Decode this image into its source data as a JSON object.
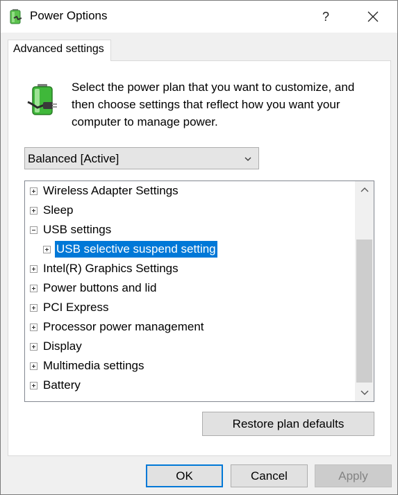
{
  "window": {
    "title": "Power Options",
    "help_label": "?",
    "close_icon": "close-icon",
    "app_icon": "power-options-icon"
  },
  "tabs": [
    {
      "label": "Advanced settings",
      "active": true
    }
  ],
  "description": "Select the power plan that you want to customize, and then choose settings that reflect how you want your computer to manage power.",
  "plan_select": {
    "value": "Balanced [Active]"
  },
  "tree": {
    "items": [
      {
        "label": "Wireless Adapter Settings",
        "expanded": false,
        "level": 0,
        "selected": false
      },
      {
        "label": "Sleep",
        "expanded": false,
        "level": 0,
        "selected": false
      },
      {
        "label": "USB settings",
        "expanded": true,
        "level": 0,
        "selected": false
      },
      {
        "label": "USB selective suspend setting",
        "expanded": false,
        "level": 1,
        "selected": true
      },
      {
        "label": "Intel(R) Graphics Settings",
        "expanded": false,
        "level": 0,
        "selected": false
      },
      {
        "label": "Power buttons and lid",
        "expanded": false,
        "level": 0,
        "selected": false
      },
      {
        "label": "PCI Express",
        "expanded": false,
        "level": 0,
        "selected": false
      },
      {
        "label": "Processor power management",
        "expanded": false,
        "level": 0,
        "selected": false
      },
      {
        "label": "Display",
        "expanded": false,
        "level": 0,
        "selected": false
      },
      {
        "label": "Multimedia settings",
        "expanded": false,
        "level": 0,
        "selected": false
      },
      {
        "label": "Battery",
        "expanded": false,
        "level": 0,
        "selected": false
      }
    ]
  },
  "buttons": {
    "restore": "Restore plan defaults",
    "ok": "OK",
    "cancel": "Cancel",
    "apply": "Apply"
  },
  "colors": {
    "selection": "#0078d7",
    "window_bg": "#f0f0f0",
    "battery_green": "#3fb83a"
  }
}
